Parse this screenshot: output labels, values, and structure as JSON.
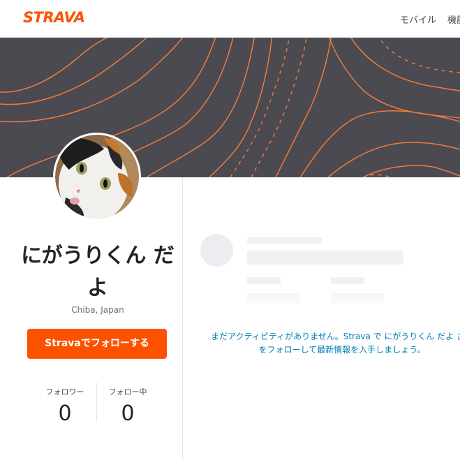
{
  "header": {
    "logo_text": "STRAVA",
    "nav": {
      "mobile": "モバイル",
      "features": "機能"
    }
  },
  "colors": {
    "brand": "#fc5200",
    "banner_bg": "#4a4a50",
    "banner_lines": "#f07a3c",
    "link": "#007fb6"
  },
  "profile": {
    "name": "にがうりくん だよ",
    "location": "Chiba, Japan",
    "follow_button": "Stravaでフォローする",
    "avatar_icon": "cat-photo-avatar"
  },
  "stats": [
    {
      "label": "フォロワー",
      "value": "0"
    },
    {
      "label": "フォロー中",
      "value": "0"
    }
  ],
  "activity": {
    "empty_message": "まだアクティビティがありません。Strava で にがうりくん だよ さんをフォローして最新情報を入手しましょう。"
  }
}
